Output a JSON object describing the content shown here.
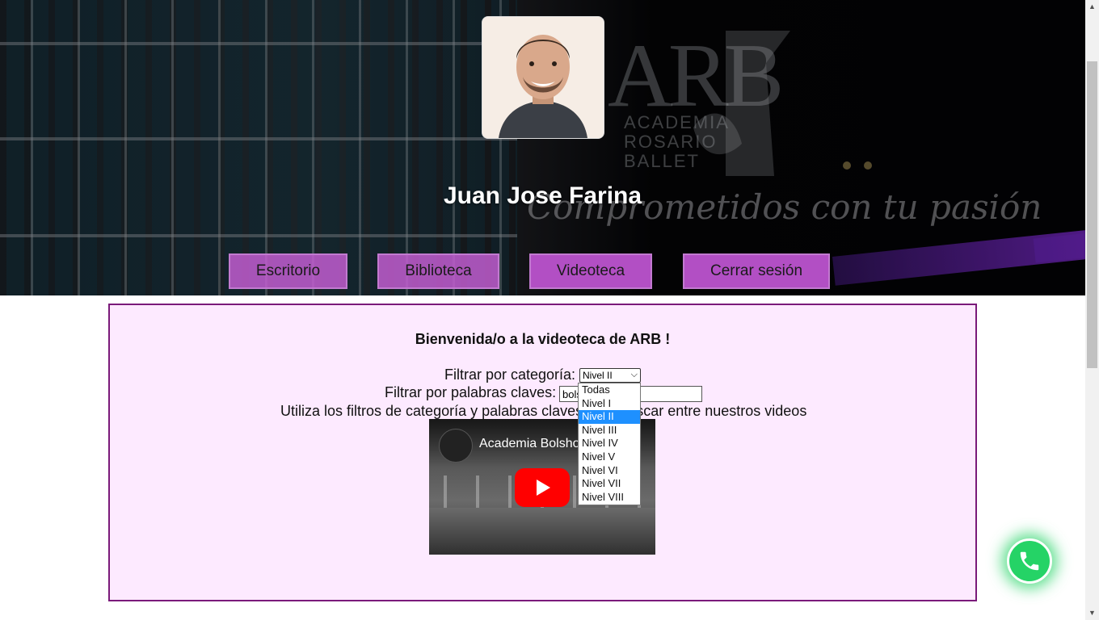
{
  "header": {
    "user_name": "Juan Jose Farina",
    "logo": {
      "letters": "ARB",
      "lines": [
        "ACADEMIA",
        "ROSARIO",
        "BALLET"
      ]
    },
    "slogan": "Comprometidos con tu pasión"
  },
  "nav": {
    "items": [
      {
        "label": "Escritorio"
      },
      {
        "label": "Biblioteca"
      },
      {
        "label": "Videoteca"
      },
      {
        "label": "Cerrar sesión"
      }
    ],
    "color": "#b24fc4"
  },
  "main": {
    "welcome": "Bienvenida/o a la videoteca de ARB !",
    "category_label": "Filtrar por categoría:",
    "category_selected": "Nivel II",
    "keywords_label": "Filtrar por palabras claves:",
    "keywords_value": "bols",
    "hint": "Utiliza los filtros de categoría y palabras claves para buscar entre nuestros videos",
    "video": {
      "title": "Academia Bolshoi"
    },
    "panel_bg": "#fdeaff",
    "panel_border": "#7a1a7a"
  },
  "dropdown": {
    "options": [
      "Todas",
      "Nivel I",
      "Nivel II",
      "Nivel III",
      "Nivel IV",
      "Nivel V",
      "Nivel VI",
      "Nivel VII",
      "Nivel VIII"
    ],
    "selected": "Nivel II"
  },
  "whatsapp": {
    "icon": "phone-icon",
    "color": "#25d366"
  }
}
